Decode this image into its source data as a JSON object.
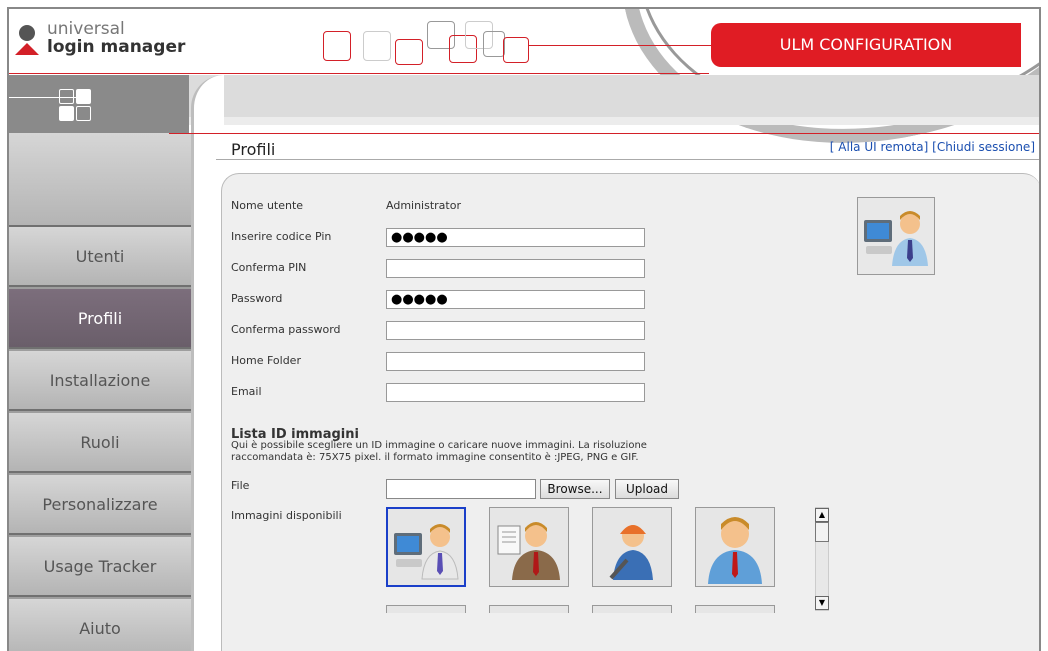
{
  "header": {
    "logo_line1": "universal",
    "logo_line2": "login manager",
    "config_title": "ULM CONFIGURATION"
  },
  "sidebar": {
    "items": [
      {
        "label": "Utenti",
        "active": false
      },
      {
        "label": "Profili",
        "active": true
      },
      {
        "label": "Installazione",
        "active": false
      },
      {
        "label": "Ruoli",
        "active": false
      },
      {
        "label": "Personalizzare",
        "active": false
      },
      {
        "label": "Usage Tracker",
        "active": false
      },
      {
        "label": "Aiuto",
        "active": false
      }
    ]
  },
  "page": {
    "title": "Profili",
    "link_remote": "[ Alla UI remota]",
    "link_close": "[Chiudi sessione]"
  },
  "form": {
    "username_label": "Nome utente",
    "username_value": "Administrator",
    "pin_label": "Inserire codice Pin",
    "pin_value": "●●●●●",
    "pin_confirm_label": "Conferma PIN",
    "pin_confirm_value": "",
    "password_label": "Password",
    "password_value": "●●●●●",
    "password_confirm_label": "Conferma password",
    "password_confirm_value": "",
    "home_label": "Home Folder",
    "home_value": "",
    "email_label": "Email",
    "email_value": ""
  },
  "images": {
    "section_title": "Lista ID immagini",
    "description": "Qui è possibile scegliere un ID immagine o caricare nuove immagini. La risoluzione raccomandata è: 75X75 pixel. il formato immagine consentito è :JPEG, PNG e GIF.",
    "file_label": "File",
    "browse_label": "Browse...",
    "upload_label": "Upload",
    "available_label": "Immagini disponibili",
    "thumbnails": [
      "computer-user-icon",
      "document-user-icon",
      "worker-user-icon",
      "business-user-icon"
    ]
  },
  "colors": {
    "brand_red": "#e01c24",
    "selected_border": "#1a3fc9",
    "active_sidebar": "#7c6e7c",
    "link_blue": "#1b4fb0"
  }
}
